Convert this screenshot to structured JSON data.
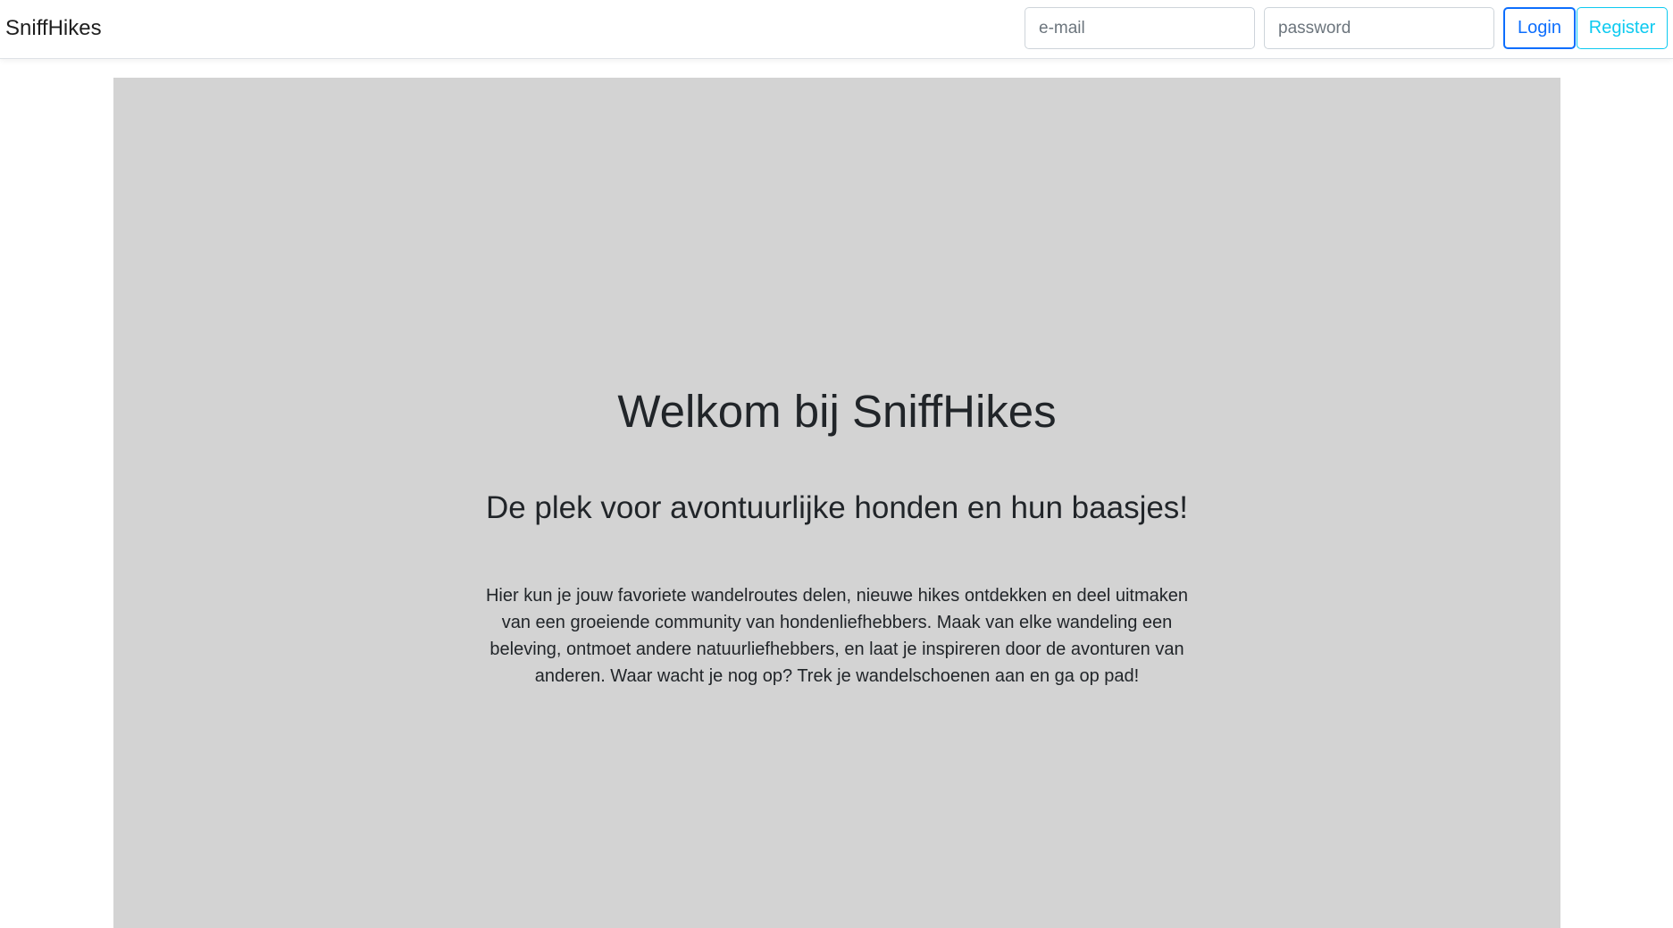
{
  "header": {
    "brand": "SniffHikes",
    "email_placeholder": "e-mail",
    "password_placeholder": "password",
    "login_label": "Login",
    "register_label": "Register"
  },
  "hero": {
    "title": "Welkom bij SniffHikes",
    "subtitle": "De plek voor avontuurlijke honden en hun baasjes!",
    "description": "Hier kun je jouw favoriete wandelroutes delen, nieuwe hikes ontdekken en deel uitmaken van een groeiende community van hondenliefhebbers. Maak van elke wandeling een beleving, ontmoet andere natuurliefhebbers, en laat je inspireren door de avonturen van anderen. Waar wacht je nog op? Trek je wandelschoenen aan en ga op pad!"
  },
  "colors": {
    "primary": "#0d6efd",
    "info": "#0dcaf0",
    "hero_background": "#d3d3d3",
    "text": "#212529"
  }
}
